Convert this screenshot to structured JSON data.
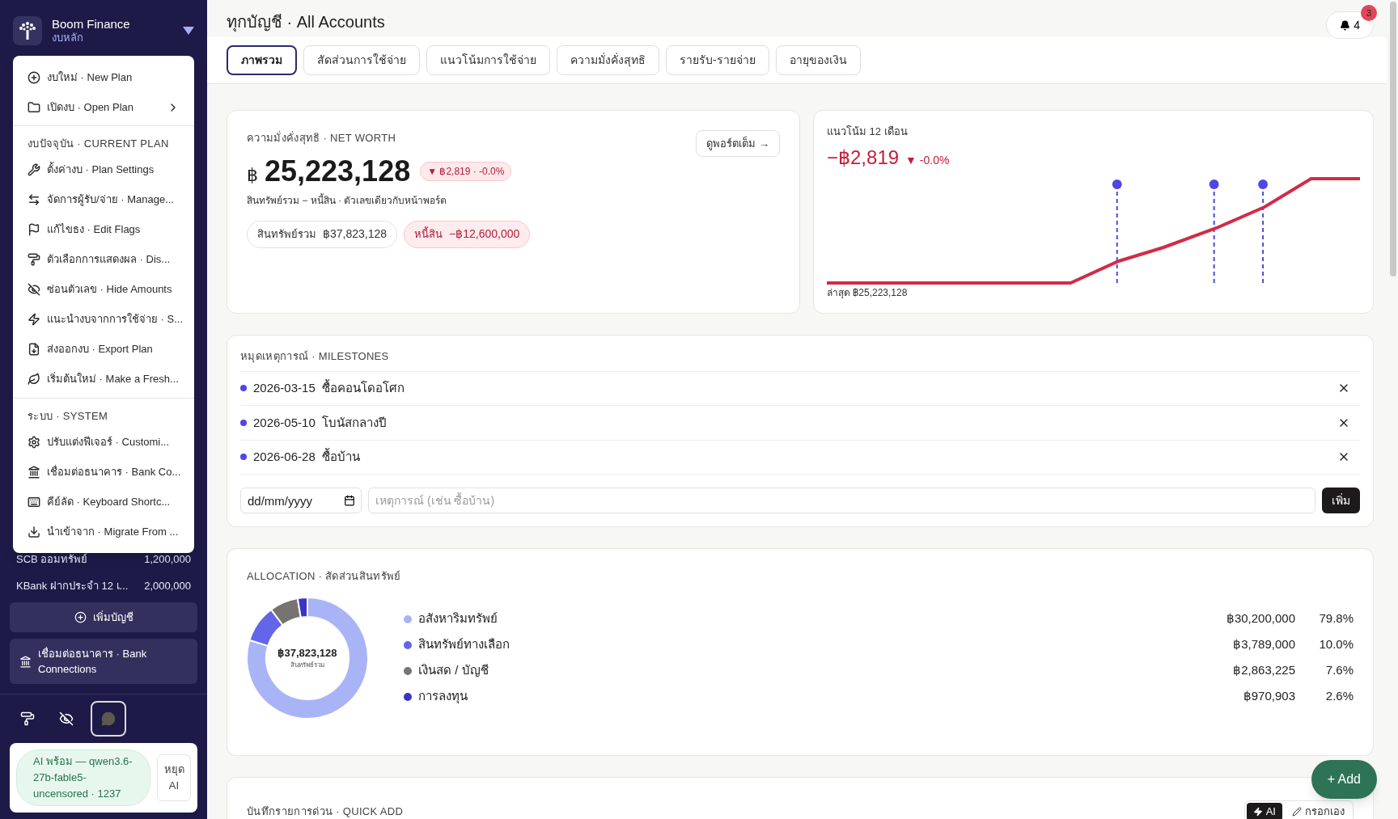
{
  "sidebar": {
    "app_name": "Boom Finance",
    "plan_name": "งบหลัก",
    "menu": [
      {
        "items": [
          {
            "label": "งบใหม่ · New Plan"
          },
          {
            "label": "เปิดงบ · Open Plan",
            "submenu": true
          }
        ]
      },
      {
        "heading": "งบปัจจุบัน · CURRENT PLAN",
        "items": [
          {
            "label": "ตั้งค่างบ · Plan Settings"
          },
          {
            "label": "จัดการผู้รับ/จ่าย · Manage..."
          },
          {
            "label": "แก้ไขธง · Edit Flags"
          },
          {
            "label": "ตัวเลือกการแสดงผล · Dis..."
          },
          {
            "label": "ซ่อนตัวเลข · Hide Amounts"
          },
          {
            "label": "แนะนำงบจากการใช้จ่าย · S..."
          },
          {
            "label": "ส่งออกงบ · Export Plan"
          },
          {
            "label": "เริ่มต้นใหม่ · Make a Fresh..."
          }
        ]
      },
      {
        "heading": "ระบบ · SYSTEM",
        "items": [
          {
            "label": "ปรับแต่งฟีเจอร์ · Customi..."
          },
          {
            "label": "เชื่อมต่อธนาคาร · Bank Co..."
          },
          {
            "label": "คีย์ลัด · Keyboard Shortc..."
          },
          {
            "label": "นำเข้าจาก · Migrate From ..."
          }
        ]
      }
    ],
    "accounts": [
      {
        "name": "SCB ออมทรัพย์",
        "balance": "1,200,000"
      },
      {
        "name": "KBank ฝากประจำ 12 เ...",
        "balance": "2,000,000"
      }
    ],
    "add_account": "เพิ่มบัญชี",
    "bank_connections": "เชื่อมต่อธนาคาร · Bank Connections",
    "toolbar": [
      {
        "selected": false
      },
      {
        "selected": false
      },
      {
        "selected": true
      }
    ],
    "ai_status": "AI พร้อม — qwen3.6-27b-fable5-uncensored · 1237",
    "ai_stop": "หยุด AI"
  },
  "header": {
    "title": "ทุกบัญชี · All Accounts",
    "notifications": "4",
    "badge": "3"
  },
  "tabs": [
    {
      "label": "ภาพรวม",
      "selected": true
    },
    {
      "label": "สัดส่วนการใช้จ่าย",
      "selected": false
    },
    {
      "label": "แนวโน้มการใช้จ่าย",
      "selected": false
    },
    {
      "label": "ความมั่งคั่งสุทธิ",
      "selected": false
    },
    {
      "label": "รายรับ-รายจ่าย",
      "selected": false
    },
    {
      "label": "อายุของเงิน",
      "selected": false
    }
  ],
  "net_worth": {
    "title": "ความมั่งคั่งสุทธิ · NET WORTH",
    "currency": "฿",
    "amount": "25,223,128",
    "change": "▼ ฿2,819 · -0.0%",
    "note": "สินทรัพย์รวม − หนี้สิน · ตัวเลขเดียวกับหน้าพอร์ต",
    "link": "ดูพอร์ตเต็ม →",
    "assets_label": "สินทรัพย์รวม",
    "assets": "฿37,823,128",
    "debt_label": "หนี้สิน",
    "debt": "−฿12,600,000"
  },
  "trend": {
    "title": "แนวโน้ม 12 เดือน",
    "value": "−฿2,819",
    "change": "▼ -0.0%",
    "latest": "ล่าสุด ฿25,223,128"
  },
  "milestones": {
    "title": "หมุดเหตุการณ์ · MILESTONES",
    "items": [
      {
        "date": "2026-03-15",
        "name": "ซื้อคอนโดอโศก"
      },
      {
        "date": "2026-05-10",
        "name": "โบนัสกลางปี"
      },
      {
        "date": "2026-06-28",
        "name": "ซื้อบ้าน"
      }
    ],
    "date_placeholder": "dd/mm/yyyy",
    "event_placeholder": "เหตุการณ์ (เช่น ซื้อบ้าน)",
    "add": "เพิ่ม"
  },
  "allocation": {
    "title": "ALLOCATION · สัดส่วนสินทรัพย์",
    "total": "฿37,823,128",
    "total_label": "สินทรัพย์รวม",
    "items": [
      {
        "amount": "฿30,200,000",
        "share": "79.8%",
        "color": "#a9b4f7"
      },
      {
        "amount": "฿3,789,000",
        "share": "10.0%",
        "color": "#6366e8"
      },
      {
        "amount": "฿2,863,225",
        "share": "7.6%",
        "color": "#777370"
      },
      {
        "amount": "฿970,903",
        "share": "2.6%",
        "color": "#3b34c4"
      }
    ],
    "chart_data": {
      "type": "donut",
      "categories": [
        "อสังหาริมทรัพย์",
        "สินทรัพย์ทางเลือก",
        "เงินสด / บัญชี",
        "การลงทุน"
      ],
      "values": [
        79.8,
        10.0,
        7.6,
        2.6
      ]
    }
  },
  "quick_add": {
    "title": "บันทึกรายการด่วน · QUICK ADD",
    "modes": [
      {
        "label": "AI",
        "selected": true
      },
      {
        "label": "กรอกเอง",
        "selected": false
      }
    ]
  },
  "fab": "+ Add"
}
